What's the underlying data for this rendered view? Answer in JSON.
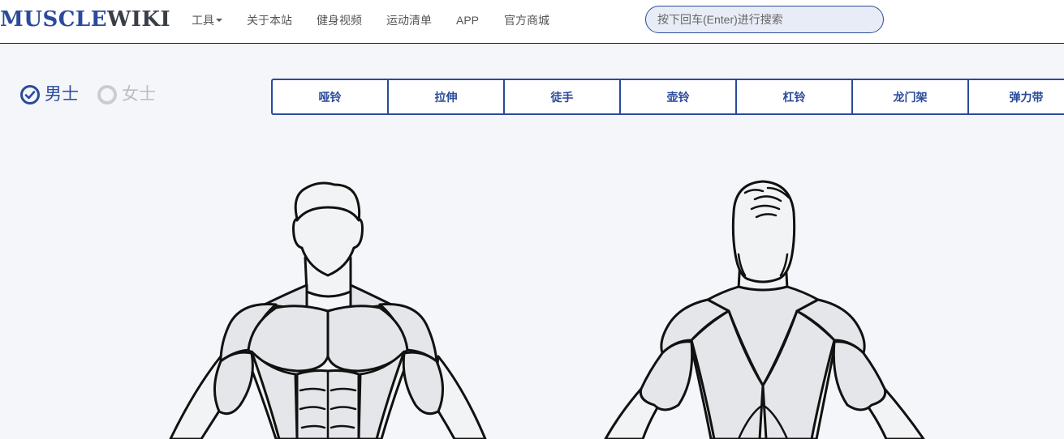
{
  "logo": {
    "part1": "MUSCLE",
    "part2": "WIKI"
  },
  "nav": {
    "tools": "工具",
    "about": "关于本站",
    "videos": "健身视频",
    "workouts": "运动清单",
    "app": "APP",
    "store": "官方商城"
  },
  "search": {
    "placeholder": "按下回车(Enter)进行搜索",
    "value": ""
  },
  "gender": {
    "male": "男士",
    "female": "女士",
    "selected": "male"
  },
  "equipment_tabs": [
    "哑铃",
    "拉伸",
    "徒手",
    "壶铃",
    "杠铃",
    "龙门架",
    "弹力带"
  ],
  "colors": {
    "brand": "#2a4b9b",
    "muscle_fill": "#e5e6e9",
    "head_fill": "#f2f3f5",
    "outline": "#111111"
  }
}
